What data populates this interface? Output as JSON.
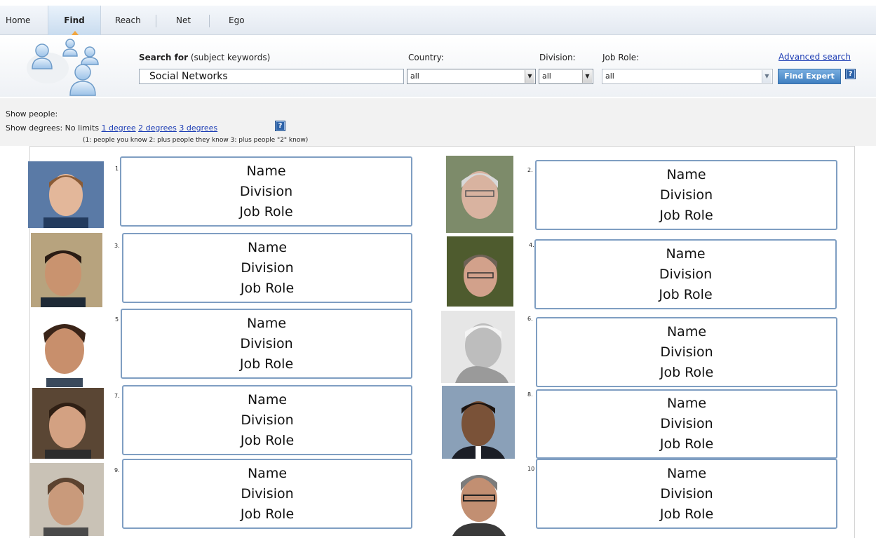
{
  "nav": {
    "tabs": [
      "Home",
      "Find",
      "Reach",
      "Net",
      "Ego"
    ],
    "active_tab": "Find"
  },
  "search": {
    "label_bold": "Search for",
    "label_rest": "(subject keywords)",
    "value": "Social Networks",
    "country_label": "Country:",
    "country_value": "all",
    "division_label": "Division:",
    "division_value": "all",
    "jobrole_label": "Job Role:",
    "jobrole_value": "all",
    "advanced_link": "Advanced search",
    "find_button": "Find Expert",
    "help": "?"
  },
  "filters": {
    "show_people": "Show people:",
    "show_degrees": "Show degrees:",
    "no_limits": "No limits",
    "degree_links": [
      "1 degree",
      "2 degrees",
      "3 degrees"
    ],
    "note": "(1: people you know 2: plus people they know 3: plus people \"2\" know)"
  },
  "results": [
    {
      "rank": "1",
      "name": "Name",
      "division": "Division",
      "job_role": "Job Role"
    },
    {
      "rank": "2.",
      "name": "Name",
      "division": "Division",
      "job_role": "Job Role"
    },
    {
      "rank": "3.",
      "name": "Name",
      "division": "Division",
      "job_role": "Job Role"
    },
    {
      "rank": "4.",
      "name": "Name",
      "division": "Division",
      "job_role": "Job Role"
    },
    {
      "rank": "5",
      "name": "Name",
      "division": "Division",
      "job_role": "Job Role"
    },
    {
      "rank": "6.",
      "name": "Name",
      "division": "Division",
      "job_role": "Job Role"
    },
    {
      "rank": "7.",
      "name": "Name",
      "division": "Division",
      "job_role": "Job Role"
    },
    {
      "rank": "8.",
      "name": "Name",
      "division": "Division",
      "job_role": "Job Role"
    },
    {
      "rank": "9.",
      "name": "Name",
      "division": "Division",
      "job_role": "Job Role"
    },
    {
      "rank": "10",
      "name": "Name",
      "division": "Division",
      "job_role": "Job Role"
    }
  ],
  "colors": {
    "accent": "#3f7fc0",
    "link": "#1f3fb5",
    "card_border": "#7f9ec2",
    "tab_marker": "#f2a640"
  }
}
